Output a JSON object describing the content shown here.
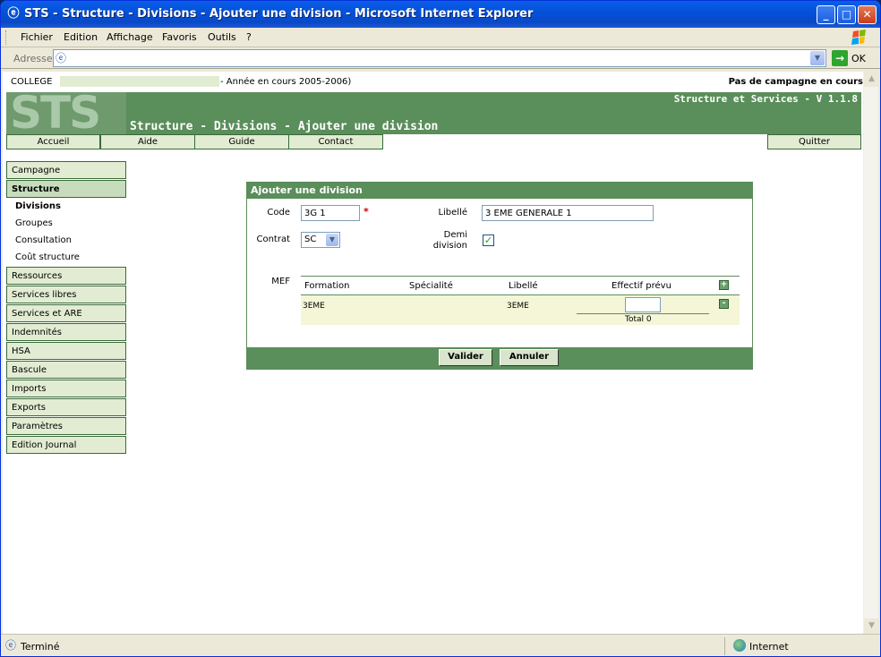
{
  "window": {
    "title": "STS - Structure - Divisions - Ajouter une division - Microsoft Internet Explorer",
    "minimize": "_",
    "maximize": "□",
    "close": "✕"
  },
  "menu": [
    "Fichier",
    "Edition",
    "Affichage",
    "Favoris",
    "Outils",
    "?"
  ],
  "address": {
    "label": "Adresse",
    "url": "",
    "go": "OK"
  },
  "status": {
    "text": "Terminé",
    "zone": "Internet"
  },
  "header": {
    "college": "COLLEGE",
    "year": "- Année en cours 2005-2006)",
    "campaign": "Pas de campagne en cours",
    "app": "Structure et Services - V 1.1.8",
    "logo": "STS",
    "page_title": "Structure - Divisions - Ajouter une division"
  },
  "nav": [
    "Accueil",
    "Aide",
    "Guide",
    "Contact",
    "Quitter"
  ],
  "sidebar": {
    "campagne": "Campagne",
    "structure": "Structure",
    "sub": [
      "Divisions",
      "Groupes",
      "Consultation",
      "Coût structure"
    ],
    "rest": [
      "Ressources",
      "Services libres",
      "Services et ARE",
      "Indemnités",
      "HSA",
      "Bascule",
      "Imports",
      "Exports",
      "Paramètres",
      "Edition Journal"
    ]
  },
  "form": {
    "title": "Ajouter une division",
    "code_label": "Code",
    "code_value": "3G 1",
    "required_mark": "*",
    "libelle_label": "Libellé",
    "libelle_value": "3 EME GENERALE 1",
    "contrat_label": "Contrat",
    "contrat_value": "SC",
    "demi_label_1": "Demi",
    "demi_label_2": "division",
    "demi_checked": true,
    "mef_label": "MEF",
    "mef_headers": [
      "Formation",
      "Spécialité",
      "Libellé",
      "Effectif prévu"
    ],
    "mef_row": {
      "formation": "3EME",
      "specialite": "",
      "libelle": "3EME",
      "effectif": ""
    },
    "total": "Total 0",
    "add": "+",
    "remove": "-",
    "valider": "Valider",
    "annuler": "Annuler"
  }
}
